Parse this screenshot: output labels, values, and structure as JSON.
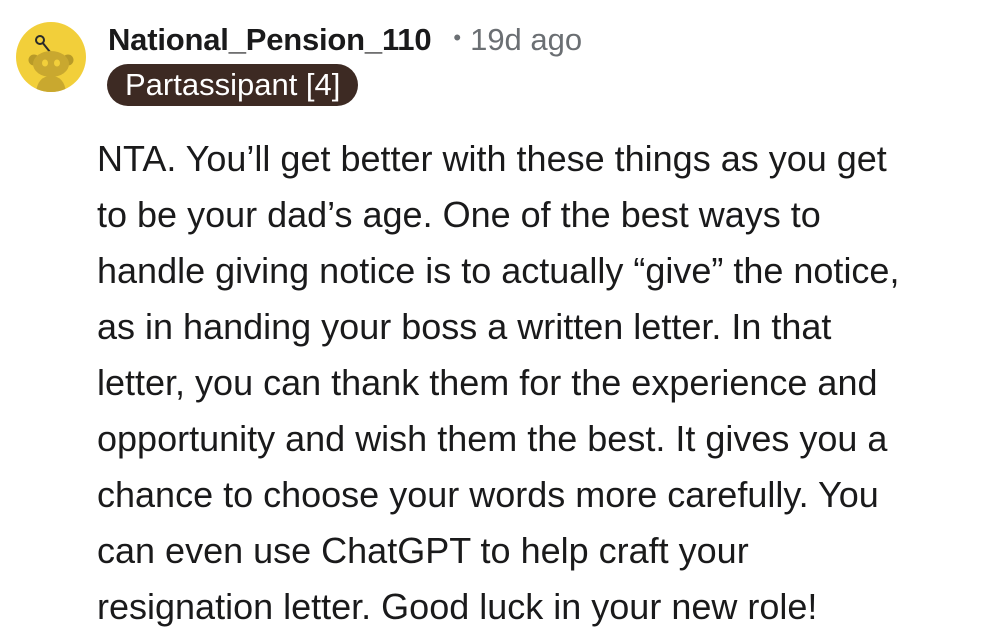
{
  "comment": {
    "author": "National_Pension_110",
    "separator": "•",
    "timestamp": "19d ago",
    "flair": "Partassipant [4]",
    "body_lines": [
      "NTA. You’ll get better with these things as you get",
      "to be your dad’s age. One of the best ways to",
      "handle giving notice is to actually “give” the notice,",
      "as in handing your boss a written letter. In that",
      "letter, you can thank them for the experience and",
      "opportunity and wish them the best. It gives you a",
      "chance to choose your words more carefully. You",
      "can even use ChatGPT to help craft your",
      "resignation letter. Good luck in your new role!"
    ]
  },
  "icons": {
    "avatar": "reddit-snoo-avatar-icon"
  },
  "colors": {
    "avatar_background": "#f2cf3a",
    "flair_background": "#3d2a23",
    "flair_text": "#ffffff",
    "username_text": "#1a1a1b",
    "meta_text": "#6b6f73",
    "body_text": "#1a1a1b"
  }
}
